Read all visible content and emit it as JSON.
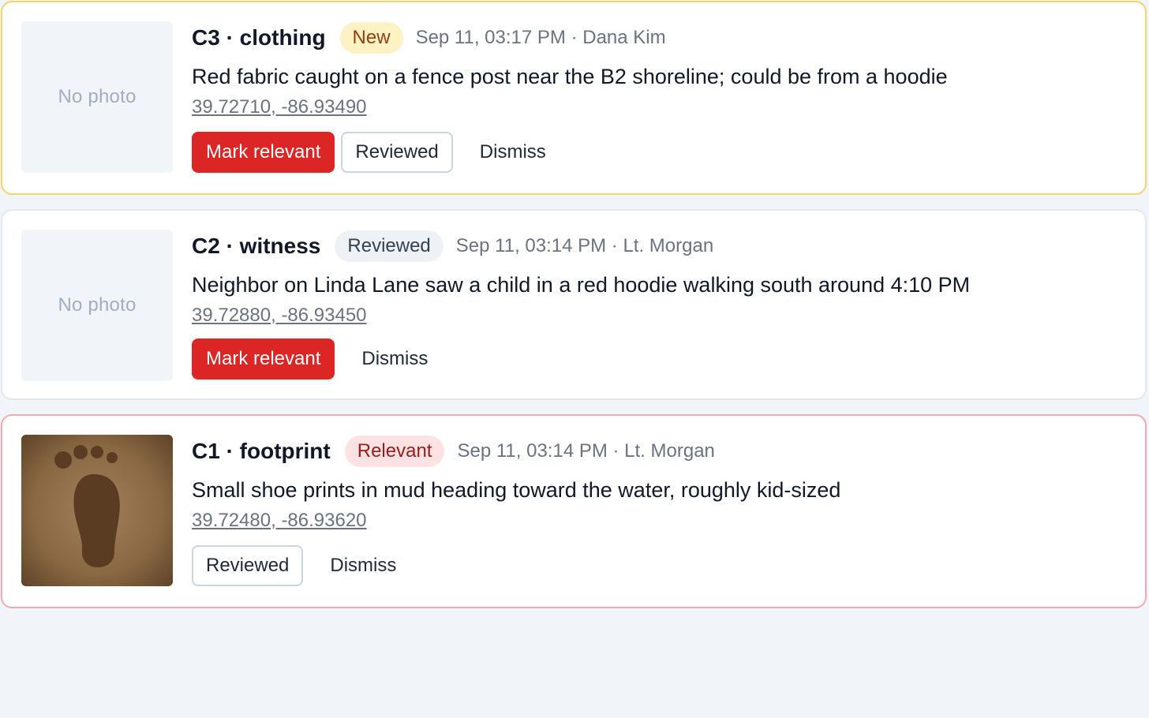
{
  "labels": {
    "no_photo": "No photo",
    "mark_relevant": "Mark relevant",
    "reviewed": "Reviewed",
    "dismiss": "Dismiss"
  },
  "colors": {
    "primary": "#dc2626",
    "new_border": "#f3d66b",
    "relevant_border": "#f5a8b2",
    "background": "#f1f4f9"
  },
  "clues": [
    {
      "id": "C3",
      "category": "clothing",
      "title": "C3 · clothing",
      "status": "New",
      "timestamp": "Sep 11, 03:17 PM",
      "reporter": "Dana Kim",
      "meta": "Sep 11, 03:17 PM · Dana Kim",
      "description": "Red fabric caught on a fence post near the B2 shoreline; could be from a hoodie",
      "coordinates": "39.72710, -86.93490",
      "has_photo": false
    },
    {
      "id": "C2",
      "category": "witness",
      "title": "C2 · witness",
      "status": "Reviewed",
      "timestamp": "Sep 11, 03:14 PM",
      "reporter": "Lt. Morgan",
      "meta": "Sep 11, 03:14 PM · Lt. Morgan",
      "description": "Neighbor on Linda Lane saw a child in a red hoodie walking south around 4:10 PM",
      "coordinates": "39.72880, -86.93450",
      "has_photo": false
    },
    {
      "id": "C1",
      "category": "footprint",
      "title": "C1 · footprint",
      "status": "Relevant",
      "timestamp": "Sep 11, 03:14 PM",
      "reporter": "Lt. Morgan",
      "meta": "Sep 11, 03:14 PM · Lt. Morgan",
      "description": "Small shoe prints in mud heading toward the water, roughly kid-sized",
      "coordinates": "39.72480, -86.93620",
      "has_photo": true,
      "photo_icon": "footprint-icon"
    }
  ]
}
